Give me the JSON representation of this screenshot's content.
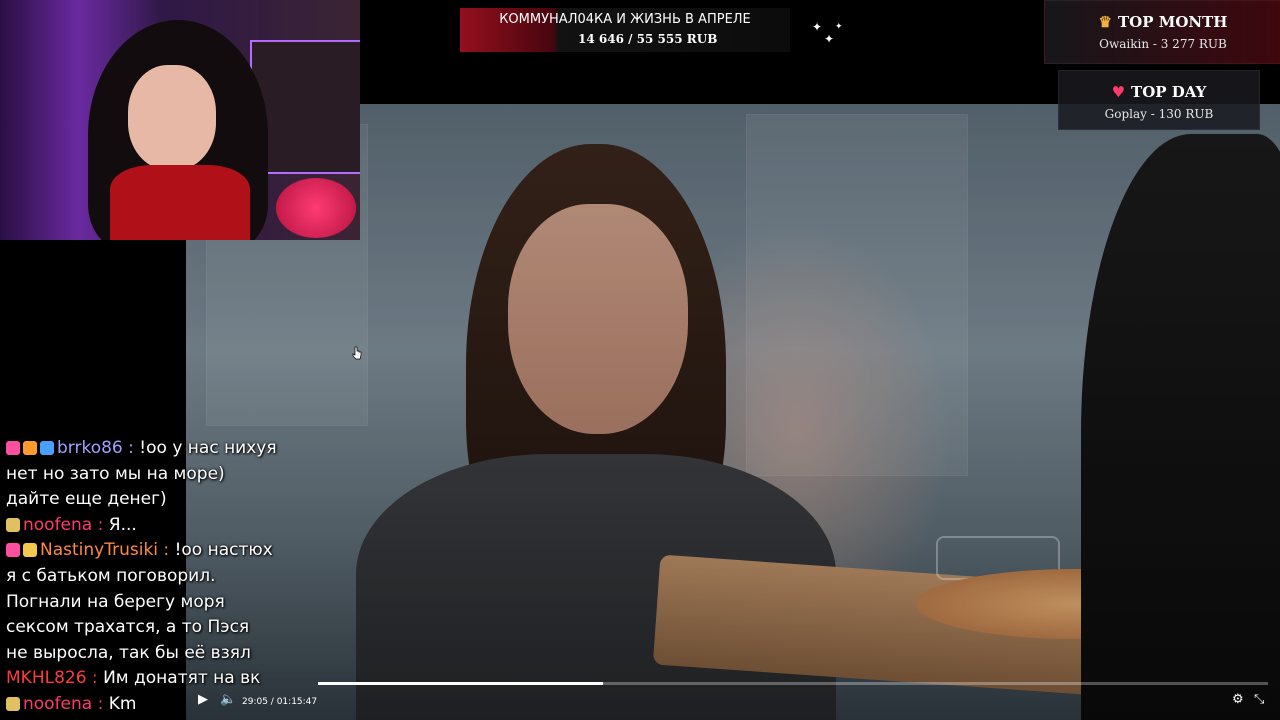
{
  "goal": {
    "title": "КОММУНАЛ04КА И ЖИЗНЬ В АПРЕЛЕ",
    "amount": "14 646 / 55 555 RUB"
  },
  "top_month": {
    "icon": "crown-icon",
    "title": "TOP MONTH",
    "line": "Owaikin  -  3 277 RUB"
  },
  "top_day": {
    "icon": "heart-icon",
    "title": "TOP DAY",
    "line": "Goplay  -  130 RUB"
  },
  "chat": {
    "messages": [
      {
        "username": "brrko86",
        "user_color": "#9ea0ff",
        "badges": [
          "heart-badge",
          "gift-badge",
          "globe-badge"
        ],
        "text_lines": [
          "!оо у нас нихуя",
          "нет но зато мы на море)",
          "дайте еще денег)"
        ]
      },
      {
        "username": "noofena",
        "user_color": "#ff3b6b",
        "badges": [
          "shield-badge"
        ],
        "text_lines": [
          "Я..."
        ]
      },
      {
        "username": "NastinyTrusiki",
        "user_color": "#ff8a3d",
        "badges": [
          "heart-badge",
          "face-badge"
        ],
        "text_lines": [
          "!оо настюх",
          "я с батьком поговорил.",
          "Погнали на берегу моря",
          "сексом трахатся, а то Пэся",
          "не выросла, так бы её взял"
        ]
      },
      {
        "username": "MKHL826",
        "user_color": "#ff3b3b",
        "badges": [],
        "text_lines": [
          "Им донатят на вк"
        ]
      },
      {
        "username": "noofena",
        "user_color": "#ff3b6b",
        "badges": [
          "shield-badge"
        ],
        "text_lines": [
          "Km"
        ]
      }
    ],
    "separator": " : "
  },
  "player": {
    "time_current": "29:05",
    "time_total": "01:15:47",
    "time_separator": " / ",
    "progress_fraction": 0.3,
    "play_icon": "play-icon",
    "volume_icon": "volume-icon",
    "settings_icon": "gear-icon",
    "fullscreen_icon": "fullscreen-exit-icon"
  },
  "colors": {
    "goal_red": "#c8142a",
    "top_month_accent": "#5a0a14",
    "webcam_neon": "#b46cff"
  }
}
